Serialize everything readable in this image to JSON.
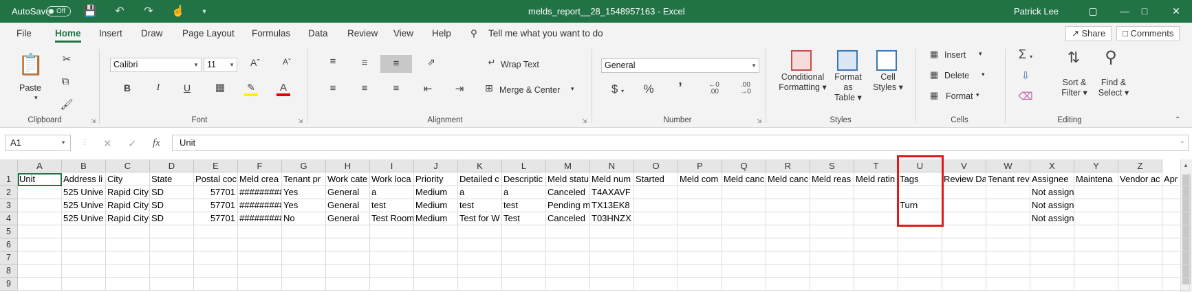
{
  "titlebar": {
    "autosave_label": "AutoSave",
    "autosave_state": "Off",
    "title": "melds_report__28_1548957163  -  Excel",
    "user": "Patrick Lee"
  },
  "menu": {
    "tabs": [
      "File",
      "Home",
      "Insert",
      "Draw",
      "Page Layout",
      "Formulas",
      "Data",
      "Review",
      "View",
      "Help"
    ],
    "active": "Home",
    "tell_me": "Tell me what you want to do",
    "share": "Share",
    "comments": "Comments"
  },
  "ribbon": {
    "clipboard": {
      "label": "Clipboard",
      "paste": "Paste"
    },
    "font": {
      "label": "Font",
      "name": "Calibri",
      "size": "11"
    },
    "alignment": {
      "label": "Alignment",
      "wrap": "Wrap Text",
      "merge": "Merge & Center"
    },
    "number": {
      "label": "Number",
      "format": "General"
    },
    "styles": {
      "label": "Styles",
      "conditional_1": "Conditional",
      "conditional_2": "Formatting",
      "table_1": "Format as",
      "table_2": "Table",
      "cell_1": "Cell",
      "cell_2": "Styles"
    },
    "cells": {
      "label": "Cells",
      "insert": "Insert",
      "delete": "Delete",
      "format": "Format"
    },
    "editing": {
      "label": "Editing",
      "sort_1": "Sort &",
      "sort_2": "Filter",
      "find_1": "Find &",
      "find_2": "Select"
    }
  },
  "formula_bar": {
    "name_box": "A1",
    "formula": "Unit"
  },
  "columns": [
    "A",
    "B",
    "C",
    "D",
    "E",
    "F",
    "G",
    "H",
    "I",
    "J",
    "K",
    "L",
    "M",
    "N",
    "O",
    "P",
    "Q",
    "R",
    "S",
    "T",
    "U",
    "V",
    "W",
    "X",
    "Y",
    "Z"
  ],
  "rows": [
    "1",
    "2",
    "3",
    "4",
    "5",
    "6",
    "7",
    "8",
    "9"
  ],
  "sheet": {
    "row1": [
      "Unit",
      "Address li",
      "City",
      "State",
      "Postal coc",
      "Meld crea",
      "Tenant pr",
      "Work cate",
      "Work loca",
      "Priority",
      "Detailed c",
      "Descriptic",
      "Meld statu",
      "Meld num",
      "Started",
      "Meld com",
      "Meld canc",
      "Meld canc",
      "Meld reas",
      "Meld ratin",
      "Tags",
      "Review Da",
      "Tenant rev",
      "Assignee",
      "Maintena",
      "Vendor ac",
      "Apr"
    ],
    "row2": [
      "",
      "525 Unive",
      "Rapid City",
      "SD",
      "57701",
      "#########",
      "Yes",
      "General",
      "a",
      "Medium",
      "a",
      "a",
      "Canceled",
      "T4AXAVF",
      "",
      "",
      "",
      "",
      "",
      "",
      "",
      "",
      "",
      "Not assigned",
      "",
      "",
      ""
    ],
    "row3": [
      "",
      "525 Unive",
      "Rapid City",
      "SD",
      "57701",
      "#########",
      "Yes",
      "General",
      "test",
      "Medium",
      "test",
      "test",
      "Pending m",
      "TX13EK8",
      "",
      "",
      "",
      "",
      "",
      "",
      "Turn",
      "",
      "",
      "Not assigned",
      "",
      "",
      ""
    ],
    "row4": [
      "",
      "525 Unive",
      "Rapid City",
      "SD",
      "57701",
      "#########",
      "No",
      "General",
      "Test Room",
      "Medium",
      "Test for W",
      "Test",
      "Canceled",
      "T03HNZX",
      "",
      "",
      "",
      "",
      "",
      "",
      "",
      "",
      "",
      "Not assigned",
      "",
      "",
      ""
    ]
  },
  "colors": {
    "excel_green": "#217346",
    "highlight_red": "#e01818"
  }
}
